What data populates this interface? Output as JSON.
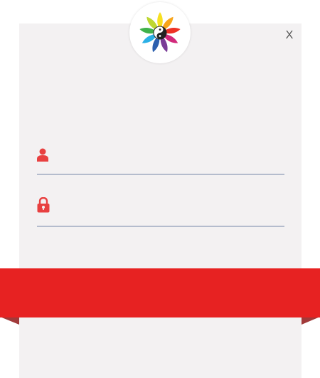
{
  "dialog": {
    "close_label": "X"
  },
  "login": {
    "username_placeholder": "",
    "username_value": "",
    "password_placeholder": "",
    "password_value": "",
    "submit_label": ""
  },
  "colors": {
    "accent": "#e72222",
    "card_background": "#f3f1f2",
    "icon": "#e84040",
    "underline": "#b4bccd"
  },
  "icons": {
    "logo": "pinwheel-yinyang-logo",
    "username": "user-icon",
    "password": "lock-icon",
    "close": "close-icon"
  }
}
